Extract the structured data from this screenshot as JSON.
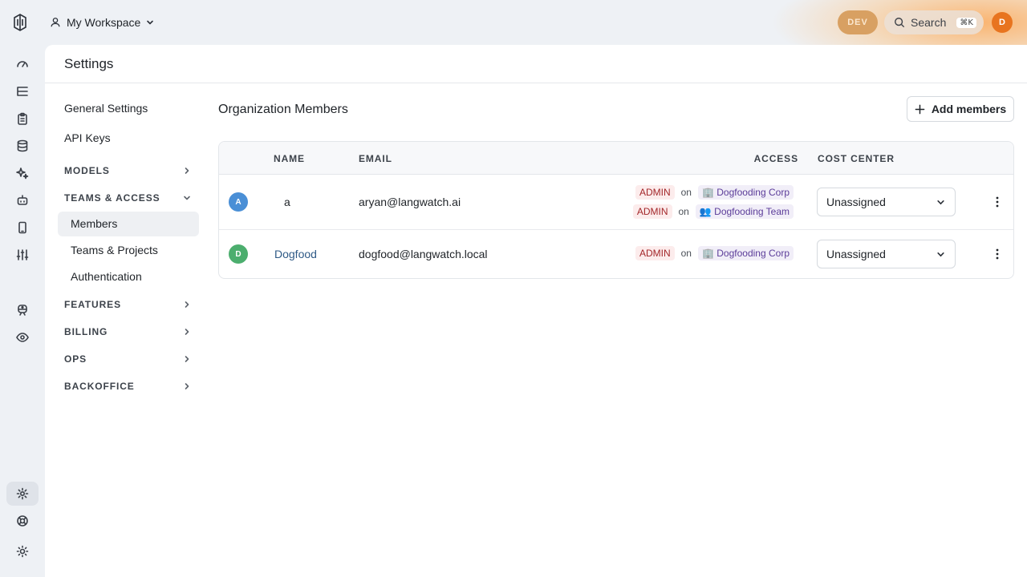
{
  "topbar": {
    "workspace_label": "My Workspace",
    "env_badge": "DEV",
    "search_label": "Search",
    "search_shortcut": "⌘K",
    "user_initial": "D"
  },
  "rail": {
    "icons": [
      "gauge-icon",
      "list-tree-icon",
      "clipboard-icon",
      "database-icon",
      "sparkles-icon",
      "bot-icon",
      "phone-icon",
      "sliders-icon",
      "train-icon",
      "eye-icon",
      "settings-icon",
      "lifebuoy-icon",
      "sun-icon"
    ],
    "active": "settings-icon"
  },
  "page": {
    "title": "Settings"
  },
  "settings_nav": {
    "general": "General Settings",
    "api_keys": "API Keys",
    "models": "MODELS",
    "teams_access": "TEAMS & ACCESS",
    "members": "Members",
    "teams_projects": "Teams & Projects",
    "authentication": "Authentication",
    "features": "FEATURES",
    "billing": "BILLING",
    "ops": "OPS",
    "backoffice": "BACKOFFICE"
  },
  "content": {
    "title": "Organization Members",
    "add_button": "Add members"
  },
  "table": {
    "headers": {
      "name": "NAME",
      "email": "EMAIL",
      "access": "ACCESS",
      "cost_center": "COST CENTER"
    },
    "rows": [
      {
        "initial": "A",
        "avatar_color": "#4a8fd6",
        "name": "a",
        "email": "aryan@langwatch.ai",
        "access": [
          {
            "role": "ADMIN",
            "on": "on",
            "scope_icon": "🏢",
            "scope": "Dogfooding Corp"
          },
          {
            "role": "ADMIN",
            "on": "on",
            "scope_icon": "👥",
            "scope": "Dogfooding Team"
          }
        ],
        "cost_center": "Unassigned"
      },
      {
        "initial": "D",
        "avatar_color": "#4cae6e",
        "name": "Dogfood",
        "email": "dogfood@langwatch.local",
        "access": [
          {
            "role": "ADMIN",
            "on": "on",
            "scope_icon": "🏢",
            "scope": "Dogfooding Corp"
          }
        ],
        "cost_center": "Unassigned"
      }
    ]
  }
}
